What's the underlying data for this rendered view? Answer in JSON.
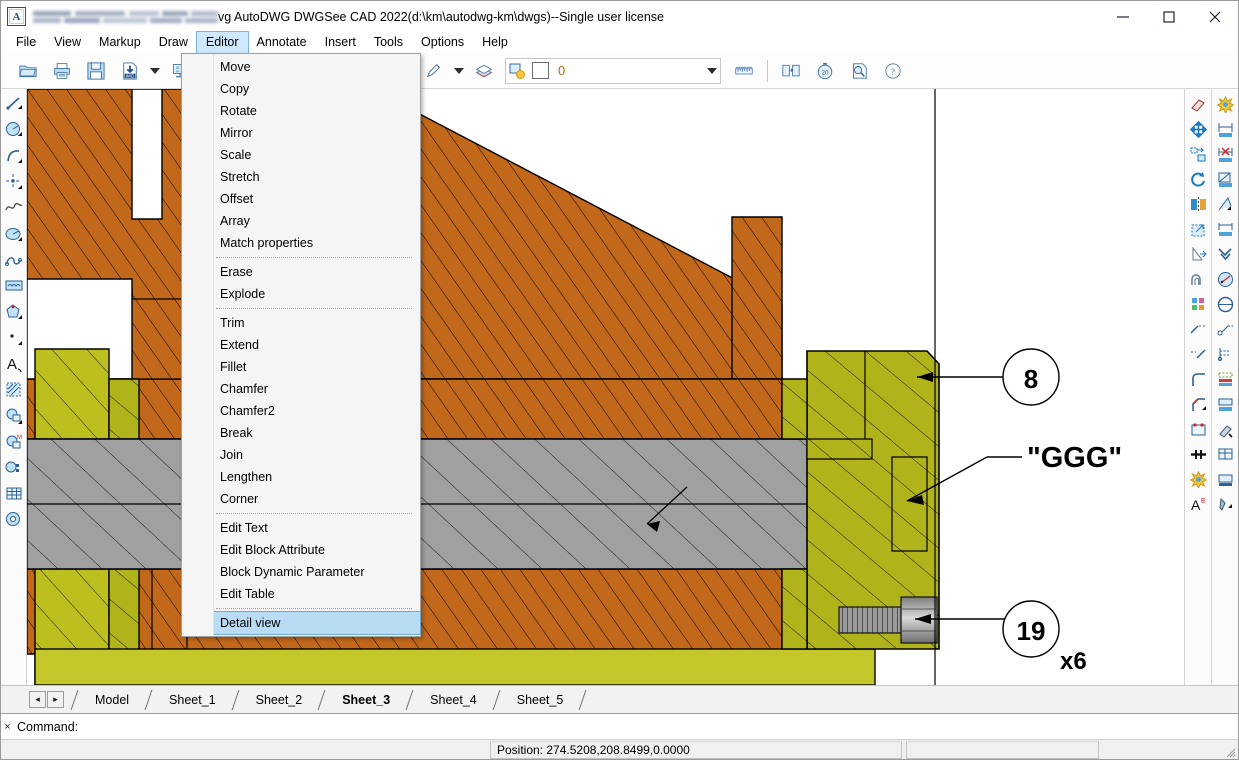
{
  "window": {
    "app_icon": "A",
    "title_suffix": "vg AutoDWG DWGSee CAD 2022(d:\\km\\autodwg-km\\dwgs)--Single user license",
    "title_redacted": true,
    "controls": {
      "minimize": "minimize-icon",
      "maximize": "maximize-icon",
      "close": "close-icon"
    }
  },
  "menubar": {
    "items": [
      {
        "label": "File",
        "mnemonic": "F",
        "active": false
      },
      {
        "label": "View",
        "mnemonic": "V",
        "active": false
      },
      {
        "label": "Markup",
        "mnemonic": "M",
        "active": false
      },
      {
        "label": "Draw",
        "mnemonic": "",
        "active": false
      },
      {
        "label": "Editor",
        "mnemonic": "E",
        "active": true
      },
      {
        "label": "Annotate",
        "mnemonic": "A",
        "active": false
      },
      {
        "label": "Insert",
        "mnemonic": "I",
        "active": false
      },
      {
        "label": "Tools",
        "mnemonic": "T",
        "active": false
      },
      {
        "label": "Options",
        "mnemonic": "O",
        "active": false
      },
      {
        "label": "Help",
        "mnemonic": "H",
        "active": false
      }
    ]
  },
  "toolbar": {
    "buttons": [
      {
        "name": "open-folder-icon",
        "title": "Open"
      },
      {
        "name": "print-icon",
        "title": "Print"
      },
      {
        "name": "save-icon",
        "title": "Save"
      },
      {
        "name": "export-image-icon",
        "title": "Export IMG"
      },
      {
        "name": "chevron-down-icon",
        "title": "More"
      },
      {
        "name": "layout-icon",
        "title": "Layout"
      }
    ],
    "right_buttons": [
      {
        "name": "pen-icon",
        "title": "Pen"
      },
      {
        "name": "chevron-down-icon",
        "title": "Pen options"
      },
      {
        "name": "layers-icon",
        "title": "Layers"
      }
    ],
    "layer": {
      "selected": "0",
      "swatch_color": "#ffffff",
      "name": "layer-selector"
    },
    "tail_buttons": [
      {
        "name": "measure-icon",
        "title": "Measure"
      },
      {
        "name": "compare-icon",
        "title": "Compare"
      },
      {
        "name": "timer-icon",
        "title": "Timer 20"
      },
      {
        "name": "zoom-window-icon",
        "title": "Zoom window"
      },
      {
        "name": "help-icon",
        "title": "Help"
      }
    ]
  },
  "editor_menu": {
    "name": "editor-dropdown",
    "groups": [
      {
        "items": [
          {
            "label": "Move",
            "icon": "move-icon"
          },
          {
            "label": "Copy",
            "icon": "copy-icon"
          },
          {
            "label": "Rotate",
            "icon": "rotate-icon"
          },
          {
            "label": "Mirror",
            "icon": "mirror-icon"
          },
          {
            "label": "Scale",
            "icon": "scale-icon"
          },
          {
            "label": "Stretch",
            "icon": "stretch-icon"
          },
          {
            "label": "Offset",
            "icon": "offset-icon"
          },
          {
            "label": "Array",
            "icon": "array-icon"
          },
          {
            "label": "Match properties",
            "icon": "match-properties-icon"
          }
        ]
      },
      {
        "items": [
          {
            "label": "Erase",
            "icon": "eraser-icon"
          },
          {
            "label": "Explode",
            "icon": "explode-icon"
          }
        ]
      },
      {
        "items": [
          {
            "label": "Trim",
            "icon": "trim-icon"
          },
          {
            "label": "Extend",
            "icon": "extend-icon"
          },
          {
            "label": "Fillet",
            "icon": "fillet-icon"
          },
          {
            "label": "Chamfer",
            "icon": "chamfer-icon"
          },
          {
            "label": "Chamfer2",
            "icon": "chamfer2-icon"
          },
          {
            "label": "Break",
            "icon": "break-icon"
          },
          {
            "label": "Join",
            "icon": "join-icon"
          },
          {
            "label": "Lengthen",
            "icon": "lengthen-icon"
          },
          {
            "label": "Corner",
            "icon": "corner-icon"
          }
        ]
      },
      {
        "items": [
          {
            "label": "Edit Text",
            "icon": "edit-text-icon"
          },
          {
            "label": "Edit Block Attribute",
            "icon": "edit-block-attribute-icon"
          },
          {
            "label": "Block Dynamic Parameter",
            "icon": "block-dynamic-parameter-icon"
          },
          {
            "label": "Edit Table",
            "icon": "edit-table-icon"
          }
        ]
      },
      {
        "items": [
          {
            "label": "Detail view",
            "icon": "detail-view-icon",
            "selected": true
          }
        ]
      }
    ]
  },
  "left_toolbar": {
    "items": [
      {
        "name": "line-icon"
      },
      {
        "name": "circle-icon"
      },
      {
        "name": "arc-icon"
      },
      {
        "name": "point-icon"
      },
      {
        "name": "spline-icon"
      },
      {
        "name": "ellipse-icon"
      },
      {
        "name": "polyline-icon"
      },
      {
        "name": "revcloud-icon"
      },
      {
        "name": "polygon-icon"
      },
      {
        "name": "dot-icon"
      },
      {
        "name": "text-icon"
      },
      {
        "name": "hatch-icon"
      },
      {
        "name": "block-icon"
      },
      {
        "name": "block-make-icon"
      },
      {
        "name": "block-attr-icon"
      },
      {
        "name": "table-icon"
      },
      {
        "name": "donut-icon"
      }
    ]
  },
  "right_toolbar": {
    "column_one": [
      {
        "name": "eraser-icon"
      },
      {
        "name": "move-icon"
      },
      {
        "name": "copy-icon"
      },
      {
        "name": "rotate-icon"
      },
      {
        "name": "mirror-icon"
      },
      {
        "name": "scale-icon"
      },
      {
        "name": "stretch-icon"
      },
      {
        "name": "offset-icon"
      },
      {
        "name": "array-icon"
      },
      {
        "name": "trim-icon"
      },
      {
        "name": "extend-icon"
      },
      {
        "name": "fillet-icon"
      },
      {
        "name": "chamfer-icon"
      },
      {
        "name": "break-icon"
      },
      {
        "name": "join-icon"
      },
      {
        "name": "explode-icon"
      },
      {
        "name": "edit-text-icon"
      }
    ],
    "column_two": [
      {
        "name": "explode-star-icon"
      },
      {
        "name": "dim-linear-icon"
      },
      {
        "name": "dim-delete-icon"
      },
      {
        "name": "dim-aligned-icon"
      },
      {
        "name": "dim-angular-icon"
      },
      {
        "name": "dim-baseline-icon"
      },
      {
        "name": "dim-continue-icon"
      },
      {
        "name": "dim-diameter-icon"
      },
      {
        "name": "dim-arc-icon"
      },
      {
        "name": "leader-simple-icon"
      },
      {
        "name": "dim-jog-icon"
      },
      {
        "name": "dim-radius-icon"
      },
      {
        "name": "leader-icon"
      },
      {
        "name": "multileader-icon"
      },
      {
        "name": "dim-table-icon"
      },
      {
        "name": "dim-style-icon"
      },
      {
        "name": "dim-tool-icon"
      }
    ]
  },
  "drawing": {
    "name": "cad-drawing-canvas",
    "annotations": [
      {
        "type": "balloon",
        "label": "8",
        "name": "balloon-8"
      },
      {
        "type": "balloon",
        "label": "19",
        "name": "balloon-19"
      },
      {
        "type": "text",
        "label": "x6",
        "name": "quantity-x6"
      },
      {
        "type": "text",
        "label": "\"GGG\"",
        "name": "label-ggg"
      }
    ],
    "colors": {
      "orange_hatch": "#c2681b",
      "olive_hatch": "#b0b31a",
      "olive_light": "#c4c72a",
      "gray_hatch": "#a0a0a0",
      "outline": "#000000",
      "background": "#ffffff"
    }
  },
  "sheet_tabs": {
    "prev_label": "◂",
    "next_label": "▸",
    "tabs": [
      {
        "label": "Model",
        "selected": false
      },
      {
        "label": "Sheet_1",
        "selected": false
      },
      {
        "label": "Sheet_2",
        "selected": false
      },
      {
        "label": "Sheet_3",
        "selected": true
      },
      {
        "label": "Sheet_4",
        "selected": false
      },
      {
        "label": "Sheet_5",
        "selected": false
      }
    ]
  },
  "command_line": {
    "close_label": "×",
    "prompt": "Command:",
    "value": ""
  },
  "status_bar": {
    "position_text": "Position: 274.5208,208.8499,0.0000",
    "right_cell": ""
  }
}
